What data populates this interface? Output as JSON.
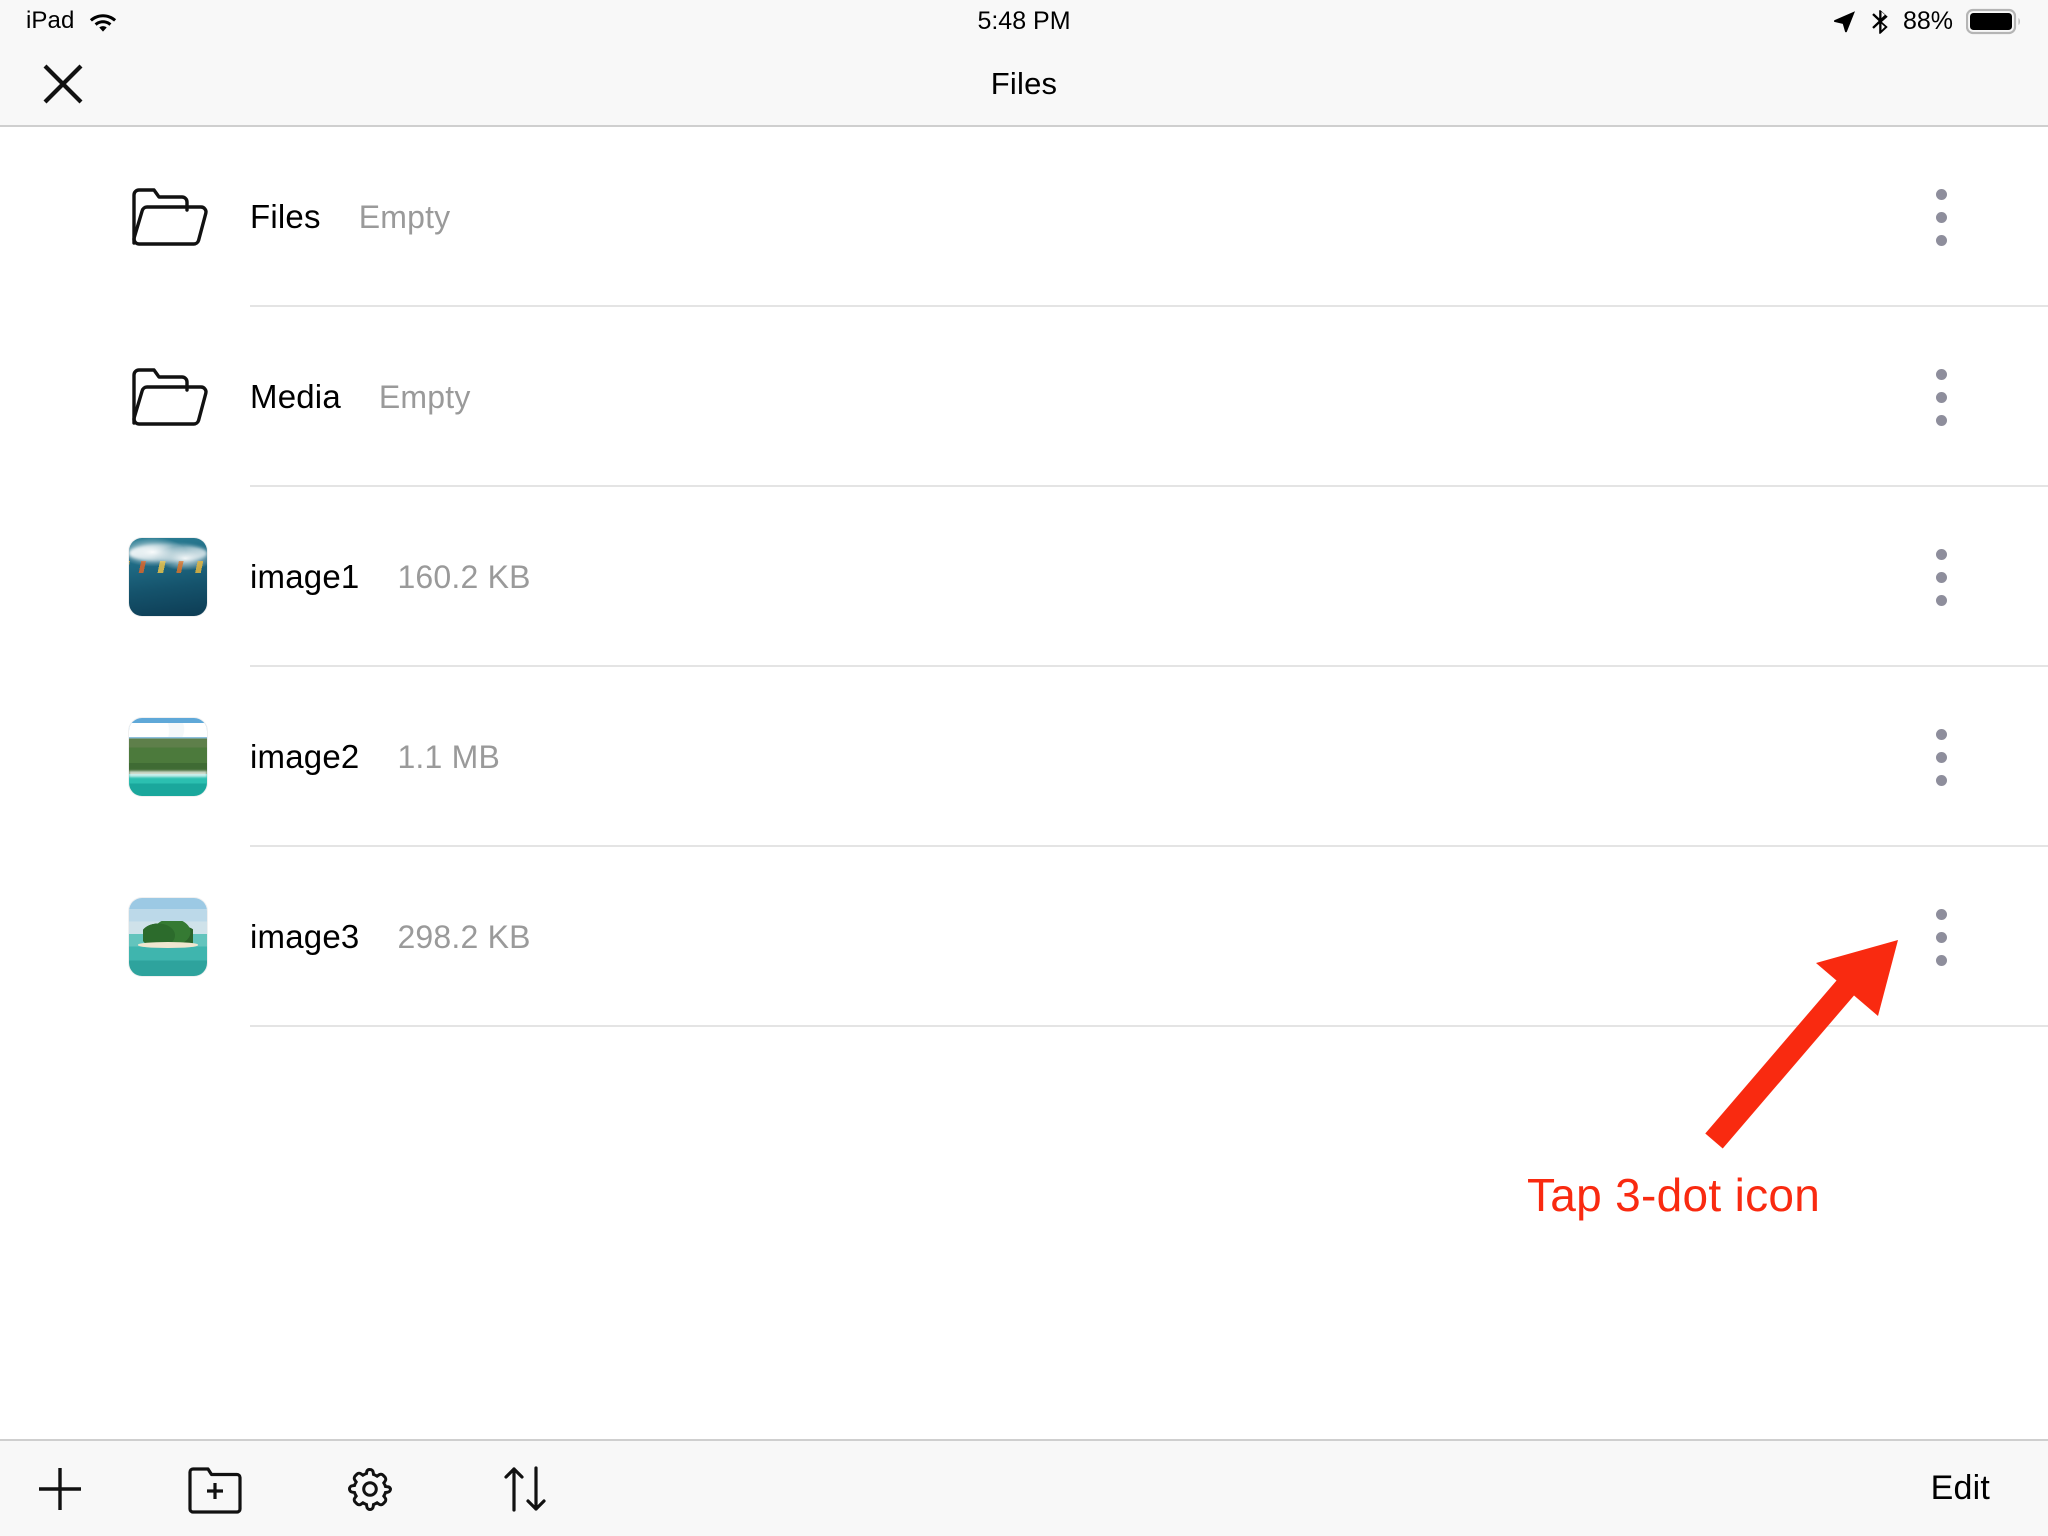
{
  "status_bar": {
    "device_label": "iPad",
    "wifi_icon": "wifi-icon",
    "time": "5:48 PM",
    "location_icon": "location-arrow-icon",
    "bluetooth_icon": "bluetooth-icon",
    "battery_percent": "88%",
    "battery_icon": "battery-icon"
  },
  "nav_bar": {
    "close_icon": "close-icon",
    "title": "Files"
  },
  "file_list": {
    "rows": [
      {
        "name": "Files",
        "meta": "Empty",
        "icon": "folder-icon",
        "menu_icon": "more-vertical-icon"
      },
      {
        "name": "Media",
        "meta": "Empty",
        "icon": "folder-icon",
        "menu_icon": "more-vertical-icon"
      },
      {
        "name": "image1",
        "meta": "160.2 KB",
        "icon": "image-thumbnail-wave",
        "menu_icon": "more-vertical-icon"
      },
      {
        "name": "image2",
        "meta": "1.1 MB",
        "icon": "image-thumbnail-coast",
        "menu_icon": "more-vertical-icon"
      },
      {
        "name": "image3",
        "meta": "298.2 KB",
        "icon": "image-thumbnail-island",
        "menu_icon": "more-vertical-icon"
      }
    ]
  },
  "annotation": {
    "text": "Tap 3-dot icon",
    "color": "#F92A10",
    "arrow": "red-arrow-pointing-up-right"
  },
  "toolbar": {
    "add_icon": "plus-icon",
    "new_folder_icon": "folder-plus-icon",
    "settings_icon": "gear-icon",
    "sort_icon": "sort-arrows-icon",
    "edit_label": "Edit"
  },
  "colors": {
    "chrome_background": "#F8F8F8",
    "content_background": "#FFFFFF",
    "separator": "#E4E4E4",
    "secondary_text": "#9A9A9A",
    "menu_dot": "#8E8E9C",
    "annotation_red": "#F92A10"
  }
}
